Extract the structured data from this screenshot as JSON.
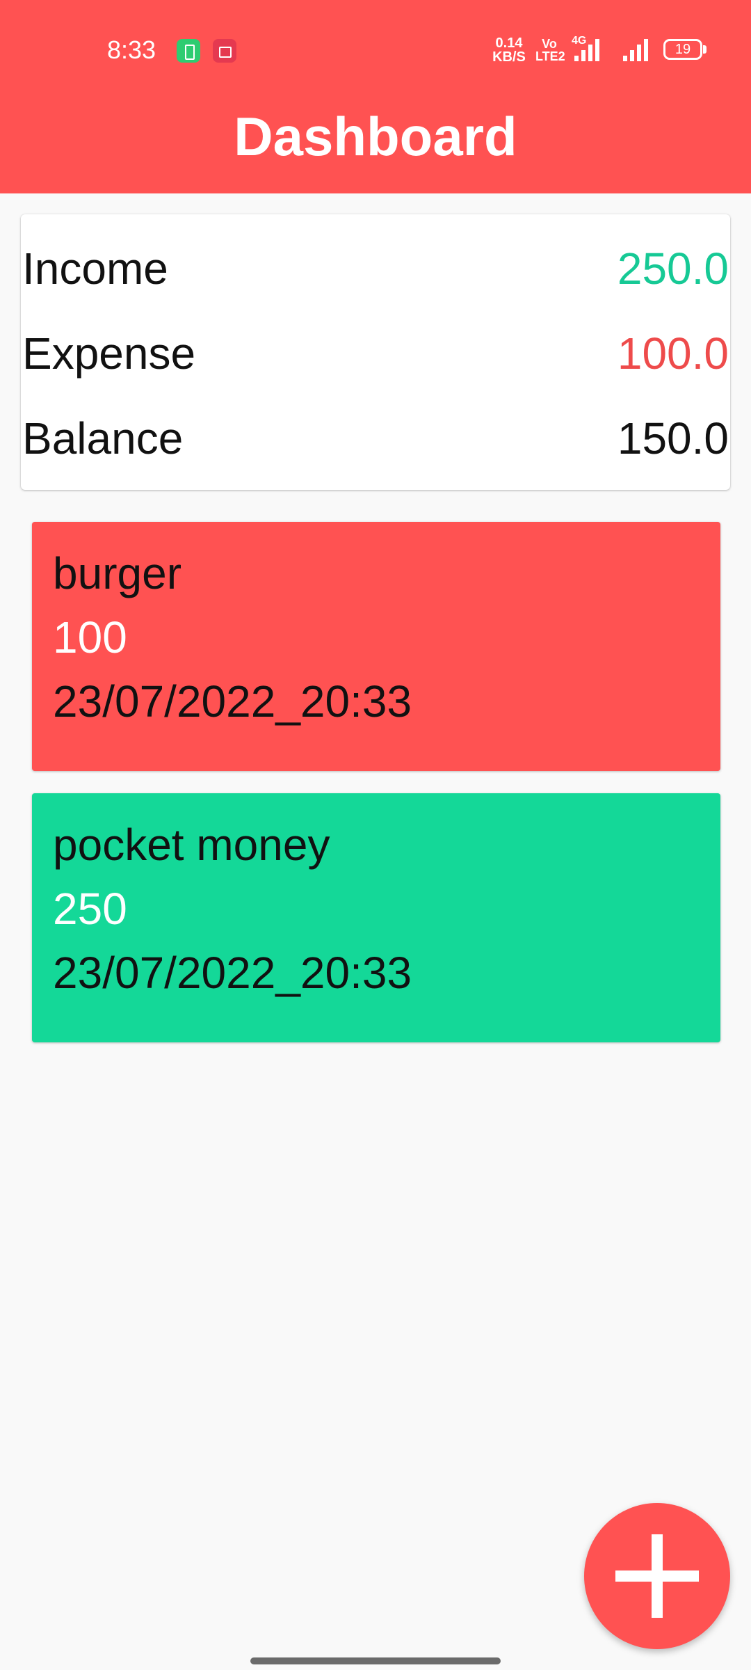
{
  "status_bar": {
    "time": "8:33",
    "network_speed_value": "0.14",
    "network_speed_unit": "KB/S",
    "volte_top": "Vo",
    "volte_bottom": "LTE2",
    "network_type": "4G",
    "battery_level": "19",
    "notification_icons": [
      "battery-saver-icon",
      "screen-record-icon"
    ]
  },
  "header": {
    "title": "Dashboard",
    "color": "#ff5252"
  },
  "summary": {
    "income_label": "Income",
    "income_value": "250.0",
    "expense_label": "Expense",
    "expense_value": "100.0",
    "balance_label": "Balance",
    "balance_value": "150.0",
    "income_color": "#16c995",
    "expense_color": "#ee4b4b"
  },
  "transactions": [
    {
      "name": "burger",
      "amount": "100",
      "date": "23/07/2022_20:33",
      "type": "expense",
      "color": "#ff5252"
    },
    {
      "name": "pocket money",
      "amount": "250",
      "date": "23/07/2022_20:33",
      "type": "income",
      "color": "#14d898"
    }
  ],
  "fab": {
    "icon": "add-icon",
    "color": "#ff5252"
  }
}
